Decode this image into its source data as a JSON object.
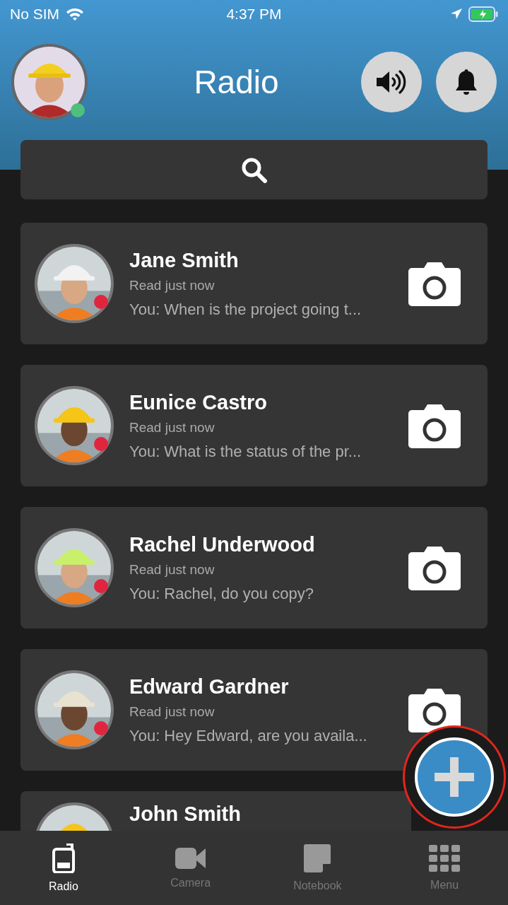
{
  "status_bar": {
    "carrier": "No SIM",
    "time": "4:37 PM"
  },
  "header": {
    "title": "Radio"
  },
  "user": {
    "color": "#4fbf7f"
  },
  "contacts": [
    {
      "name": "Jane Smith",
      "read": "Read just now",
      "message": "You: When is the project going t...",
      "color": "#e0263f"
    },
    {
      "name": "Eunice Castro",
      "read": "Read just now",
      "message": "You: What is the status of the pr...",
      "color": "#e0263f"
    },
    {
      "name": "Rachel Underwood",
      "read": "Read just now",
      "message": "You: Rachel, do you copy?",
      "color": "#e0263f"
    },
    {
      "name": "Edward Gardner",
      "read": "Read just now",
      "message": "You: Hey Edward, are you availa...",
      "color": "#e0263f"
    },
    {
      "name": "John Smith"
    }
  ],
  "nav": [
    {
      "label": "Radio",
      "kind": "radio",
      "selected": true
    },
    {
      "label": "Camera",
      "kind": "camera",
      "selected": false
    },
    {
      "label": "Notebook",
      "kind": "notebook",
      "selected": false
    },
    {
      "label": "Menu",
      "kind": "menu",
      "selected": false
    }
  ]
}
